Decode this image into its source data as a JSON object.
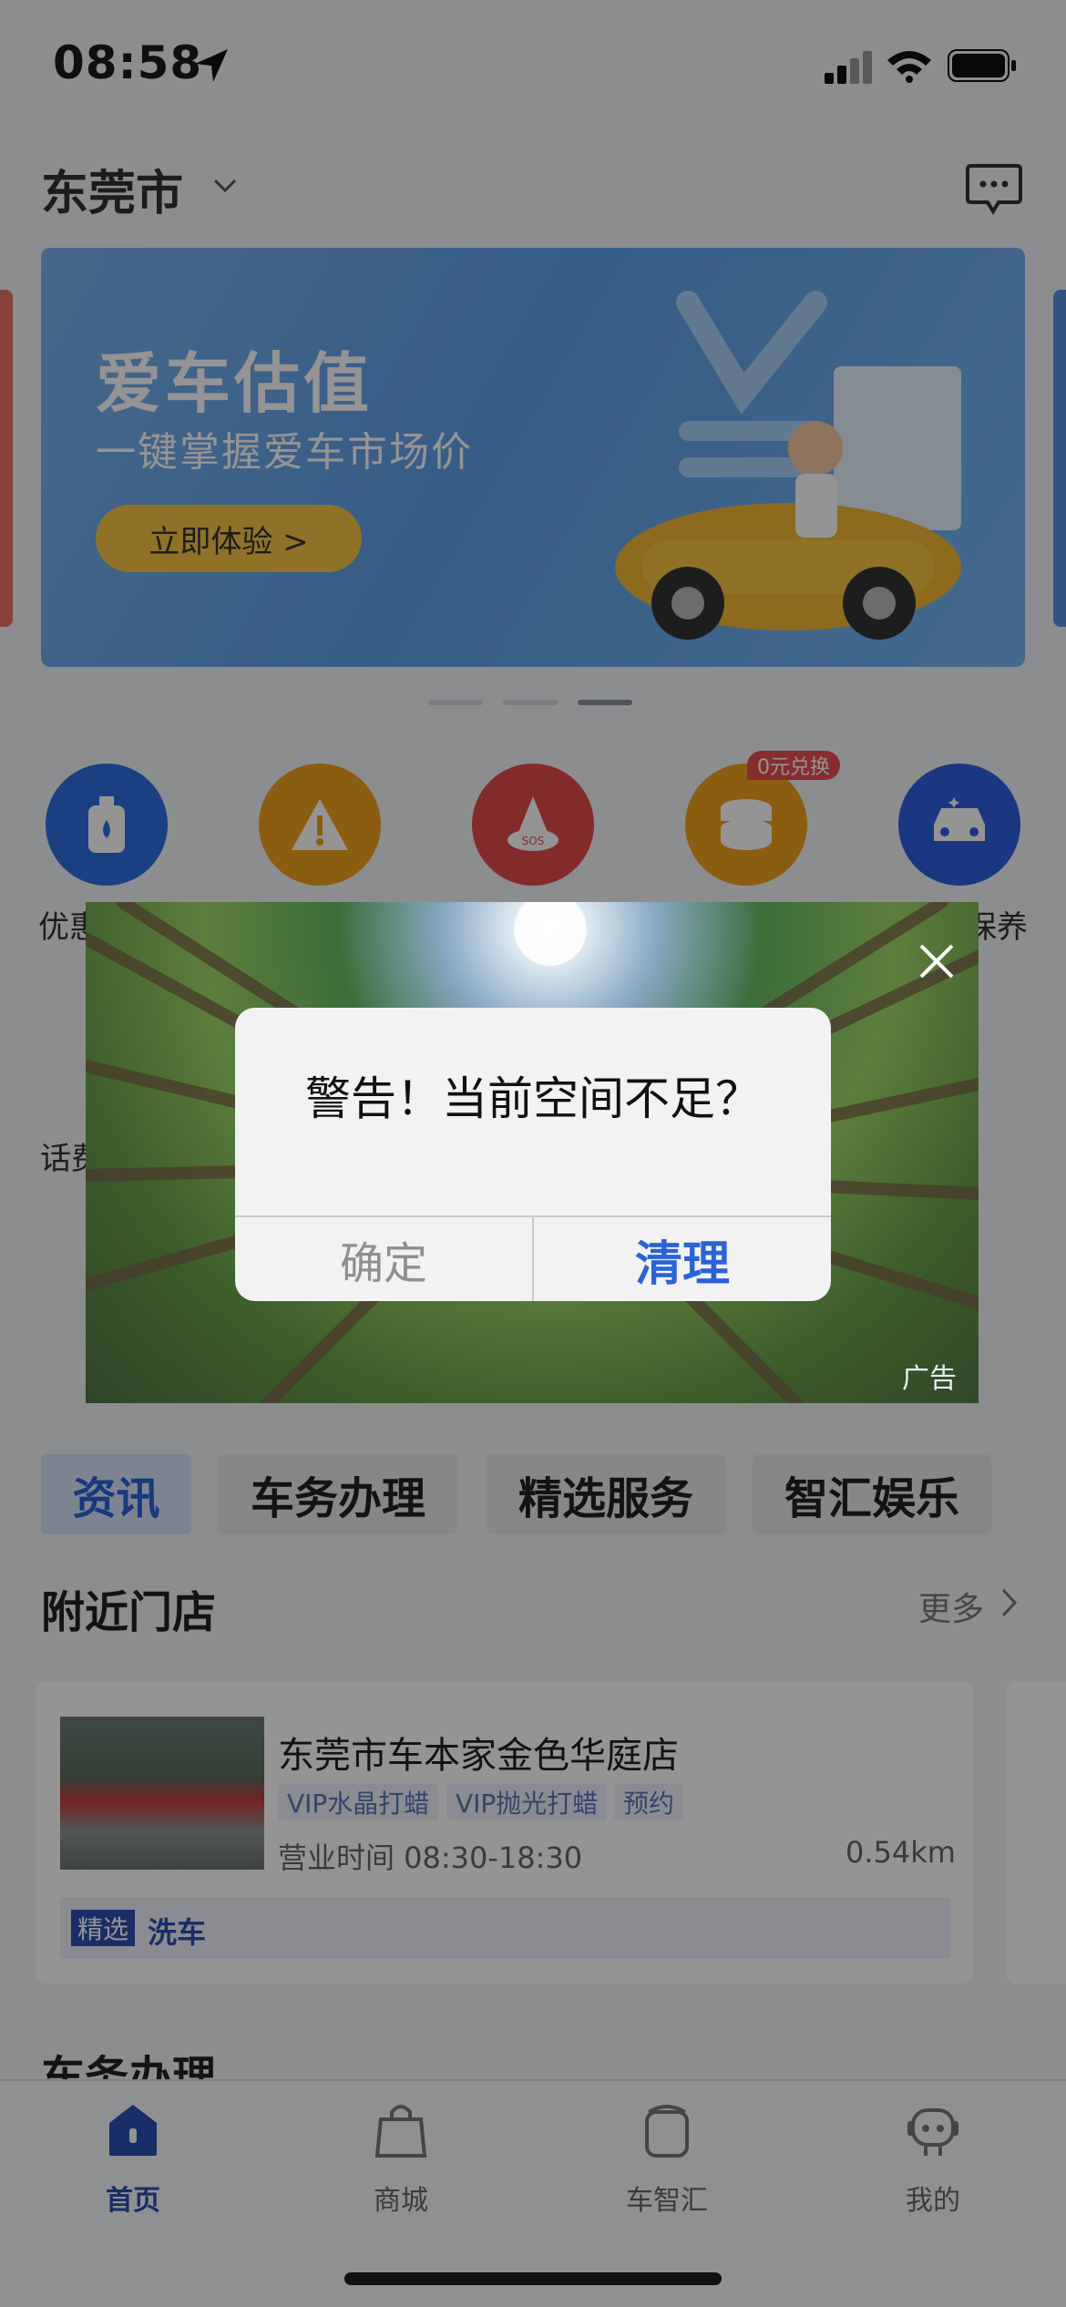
{
  "status_bar": {
    "time": "08:58"
  },
  "header": {
    "city": "东莞市"
  },
  "banner": {
    "title": "爱车估值",
    "subtitle": "一键掌握爱车市场价",
    "button": "立即体验 >"
  },
  "quick_icons": [
    {
      "label": "优惠",
      "icon": "oil-bottle-icon",
      "color": "#2f6fe0"
    },
    {
      "label": "",
      "icon": "warning-icon",
      "color": "#f0a01e"
    },
    {
      "label": "",
      "icon": "sos-cone-icon",
      "color": "#e24a4a"
    },
    {
      "label": "",
      "icon": "coin-stack-icon",
      "color": "#f0a01e",
      "badge": "0元兑换"
    },
    {
      "label": "保养",
      "icon": "car-wash-icon",
      "color": "#2f5fe0"
    }
  ],
  "row2_left_label": "话费",
  "tabs": [
    "资讯",
    "车务办理",
    "精选服务",
    "智汇娱乐"
  ],
  "nearby": {
    "title": "附近门店",
    "more": "更多",
    "store": {
      "name": "东莞市车本家金色华庭店",
      "tags": [
        "VIP水晶打蜡",
        "VIP抛光打蜡",
        "预约"
      ],
      "hours": "营业时间 08:30-18:30",
      "distance": "0.54km",
      "feature_badge": "精选",
      "feature_text": "洗车"
    }
  },
  "section2_title": "车务办理",
  "tabbar": [
    {
      "label": "首页",
      "icon": "home-icon",
      "active": true
    },
    {
      "label": "商城",
      "icon": "bag-icon",
      "active": false
    },
    {
      "label": "车智汇",
      "icon": "cup-icon",
      "active": false
    },
    {
      "label": "我的",
      "icon": "robot-icon",
      "active": false
    }
  ],
  "ad_overlay": {
    "label": "广告"
  },
  "alert": {
    "message": "警告！当前空间不足？",
    "cancel": "确定",
    "confirm": "清理"
  }
}
